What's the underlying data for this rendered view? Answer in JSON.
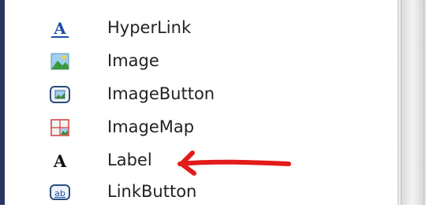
{
  "toolbox": {
    "items": [
      {
        "label": "HyperLink",
        "icon": "hyperlink-icon"
      },
      {
        "label": "Image",
        "icon": "image-icon"
      },
      {
        "label": "ImageButton",
        "icon": "image-button-icon"
      },
      {
        "label": "ImageMap",
        "icon": "image-map-icon"
      },
      {
        "label": "Label",
        "icon": "label-icon"
      },
      {
        "label": "LinkButton",
        "icon": "link-button-icon"
      }
    ]
  },
  "annotation": {
    "arrow_color": "#e21b1b",
    "points_to": "Label"
  },
  "colors": {
    "left_rule": "#2b3560",
    "text": "#222222"
  }
}
